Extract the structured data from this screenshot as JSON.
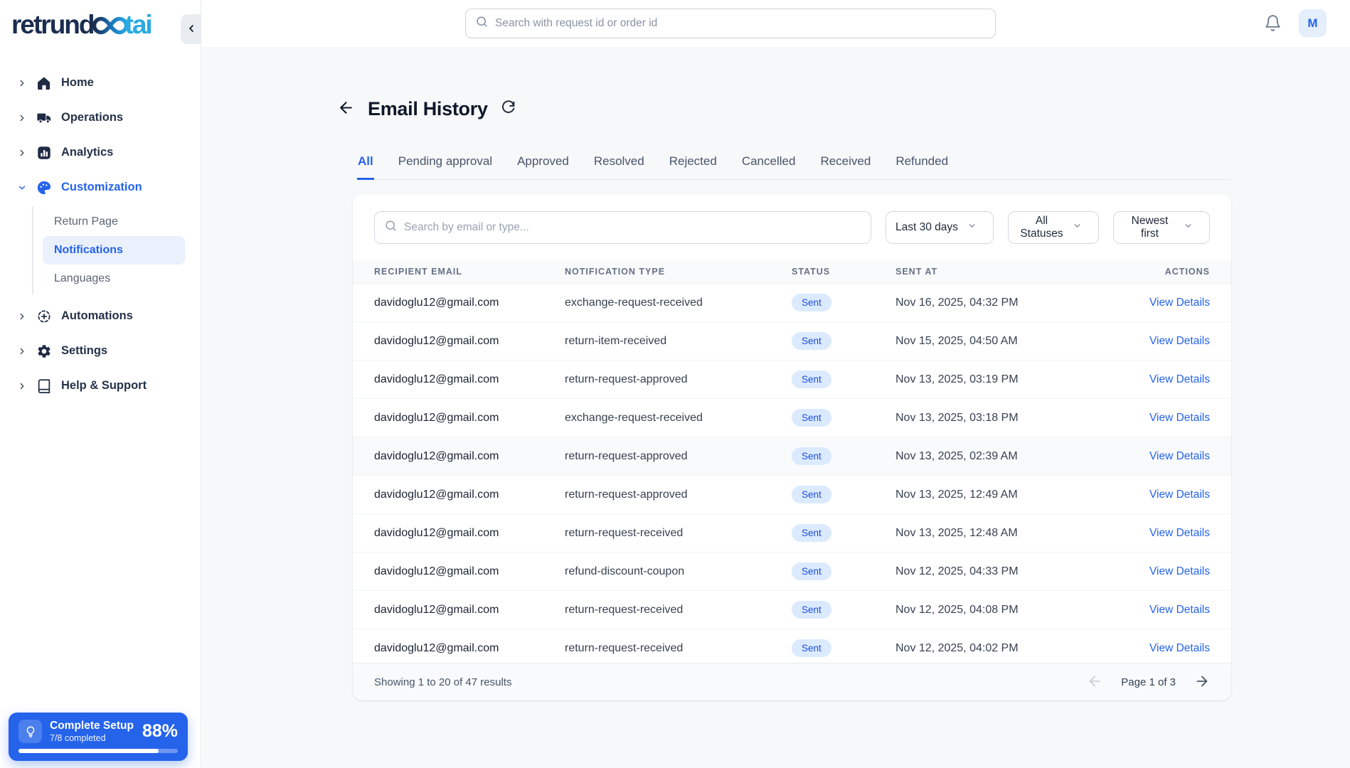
{
  "brand": {
    "logo_part_dark": "retrund",
    "logo_part_light": "tai"
  },
  "topbar": {
    "search_placeholder": "Search with request id or order id",
    "avatar_initial": "M"
  },
  "sidebar": {
    "items": [
      {
        "label": "Home"
      },
      {
        "label": "Operations"
      },
      {
        "label": "Analytics"
      },
      {
        "label": "Customization"
      },
      {
        "label": "Automations"
      },
      {
        "label": "Settings"
      },
      {
        "label": "Help & Support"
      }
    ],
    "customization_children": [
      {
        "label": "Return Page"
      },
      {
        "label": "Notifications"
      },
      {
        "label": "Languages"
      }
    ],
    "setup": {
      "title": "Complete Setup",
      "subtitle": "7/8 completed",
      "percent_label": "88%",
      "progress": 88
    }
  },
  "page": {
    "title": "Email History",
    "tabs": [
      "All",
      "Pending approval",
      "Approved",
      "Resolved",
      "Rejected",
      "Cancelled",
      "Received",
      "Refunded"
    ],
    "active_tab": "All",
    "filters": {
      "search_placeholder": "Search by email or type...",
      "date_range": "Last 30 days",
      "status_filter": "All Statuses",
      "sort_order": "Newest first"
    },
    "table": {
      "columns": [
        "RECIPIENT EMAIL",
        "NOTIFICATION TYPE",
        "STATUS",
        "SENT AT",
        "ACTIONS"
      ],
      "action_label": "View Details",
      "rows": [
        {
          "email": "davidoglu12@gmail.com",
          "type": "exchange-request-received",
          "status": "Sent",
          "sent_at": "Nov 16, 2025, 04:32 PM"
        },
        {
          "email": "davidoglu12@gmail.com",
          "type": "return-item-received",
          "status": "Sent",
          "sent_at": "Nov 15, 2025, 04:50 AM"
        },
        {
          "email": "davidoglu12@gmail.com",
          "type": "return-request-approved",
          "status": "Sent",
          "sent_at": "Nov 13, 2025, 03:19 PM"
        },
        {
          "email": "davidoglu12@gmail.com",
          "type": "exchange-request-received",
          "status": "Sent",
          "sent_at": "Nov 13, 2025, 03:18 PM"
        },
        {
          "email": "davidoglu12@gmail.com",
          "type": "return-request-approved",
          "status": "Sent",
          "sent_at": "Nov 13, 2025, 02:39 AM",
          "highlighted": true
        },
        {
          "email": "davidoglu12@gmail.com",
          "type": "return-request-approved",
          "status": "Sent",
          "sent_at": "Nov 13, 2025, 12:49 AM"
        },
        {
          "email": "davidoglu12@gmail.com",
          "type": "return-request-received",
          "status": "Sent",
          "sent_at": "Nov 13, 2025, 12:48 AM"
        },
        {
          "email": "davidoglu12@gmail.com",
          "type": "refund-discount-coupon",
          "status": "Sent",
          "sent_at": "Nov 12, 2025, 04:33 PM"
        },
        {
          "email": "davidoglu12@gmail.com",
          "type": "return-request-received",
          "status": "Sent",
          "sent_at": "Nov 12, 2025, 04:08 PM"
        },
        {
          "email": "davidoglu12@gmail.com",
          "type": "return-request-received",
          "status": "Sent",
          "sent_at": "Nov 12, 2025, 04:02 PM"
        }
      ]
    },
    "footer": {
      "summary": "Showing 1 to 20 of 47 results",
      "page_label": "Page 1 of 3"
    }
  },
  "colors": {
    "accent": "#2563eb",
    "badge_bg": "#dbeafe",
    "badge_text": "#1d4ed8",
    "logo_dark": "#1b2d4f",
    "logo_light": "#29aae1",
    "setup_bg": "#2563eb"
  }
}
